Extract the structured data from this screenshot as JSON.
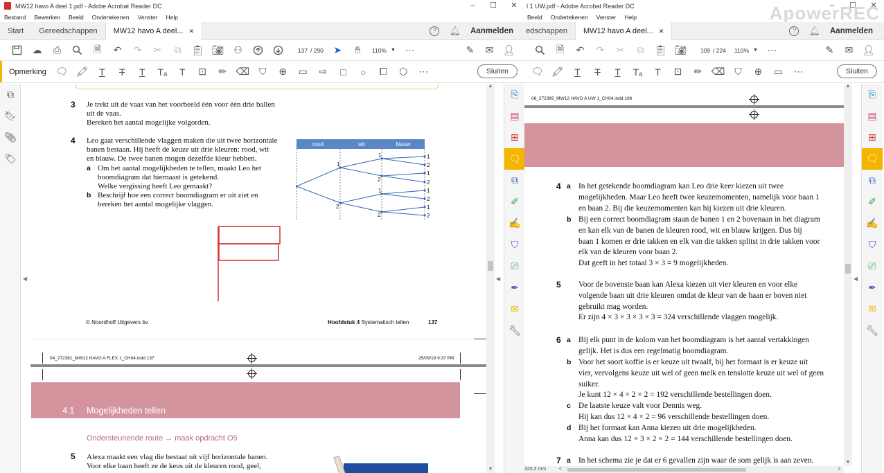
{
  "left_window": {
    "title": "MW12 havo A deel 1.pdf - Adobe Acrobat Reader DC",
    "menu": [
      "Bestand",
      "Bewerken",
      "Beeld",
      "Ondertekenen",
      "Venster",
      "Help"
    ],
    "tabs": {
      "start": "Start",
      "tools": "Gereedschappen",
      "doc": "MW12 havo A deel..."
    },
    "signin": "Aanmelden",
    "page_current": "137",
    "page_total": "/ 290",
    "zoom": "110%",
    "comment_label": "Opmerking",
    "close_label": "Sluiten"
  },
  "right_window": {
    "title": "l 1 UW.pdf - Adobe Acrobat Reader DC",
    "menu": [
      "Beeld",
      "Ondertekenen",
      "Venster",
      "Help"
    ],
    "tabs": {
      "tools": "edschappen",
      "doc": "MW12 havo A deel..."
    },
    "signin": "Aanmelden",
    "page_current": "109",
    "page_total": "/ 224",
    "zoom": "110%",
    "close_label": "Sluiten",
    "watermark": "ApowerREC",
    "status_size": "320,3 mm"
  },
  "left_doc": {
    "q3": {
      "num": "3",
      "lines": [
        "Je trekt uit de vaas van het voorbeeld één voor één drie ballen",
        "uit de vaas.",
        "Bereken het aantal mogelijke volgorden."
      ]
    },
    "q4": {
      "num": "4",
      "intro": [
        "Leo gaat verschillende vlaggen maken die uit twee horizontale",
        "banen bestaan. Hij heeft de keuze uit drie kleuren: rood, wit",
        "en blauw. De twee banen mogen dezelfde kleur hebben."
      ],
      "a_label": "a",
      "a_lines": [
        "Om het aantal mogelijkheden te tellen, maakt Leo het",
        "boomdiagram dat hiernaast is getekend.",
        "Welke vergissing heeft Leo gemaakt?"
      ],
      "b_label": "b",
      "b_lines": [
        "Beschrijf hoe een correct boomdiagram er uit ziet en",
        "bereken het aantal mogelijke vlaggen."
      ]
    },
    "tree": {
      "headers": [
        "rood",
        "wit",
        "blauw"
      ],
      "level1": [
        "1",
        "2"
      ],
      "level2": [
        "1",
        "2",
        "1",
        "2"
      ],
      "leaves": [
        "1",
        "2",
        "1",
        "2",
        "1",
        "2",
        "1",
        "2"
      ]
    },
    "footer": {
      "copyright": "© Noordhoff Uitgevers bv",
      "chapter_bold": "Hoofdstuk 4",
      "chapter_rest": " Systematisch tellen",
      "page": "137"
    },
    "slug": {
      "file": "04_272381_MW12 HAVO A FLEX 1_CH04.indd   137",
      "date": "25/09/19   9:37 PM"
    },
    "section": {
      "num": "4.1",
      "title": "Mogelijkheden tellen"
    },
    "route": "Ondersteunende route → maak opdracht O5",
    "q5": {
      "num": "5",
      "lines": [
        "Alexa maakt een vlag die bestaat uit vijf horizontale banen.",
        "Voor elke baan heeft ze de keus uit de kleuren rood, geel,"
      ]
    }
  },
  "right_doc": {
    "slug": "06_272389_MW12 HAVO A UW 1_CH04.indd   108",
    "answers": [
      {
        "num": "4",
        "label": "a",
        "lines": [
          "In het getekende boomdiagram kan Leo drie keer kiezen uit twee",
          "mogelijkheden. Maar Leo heeft twee keuzemomenten, namelijk voor baan 1",
          "en baan 2. Bij die keuzemomenten kan hij kiezen uit drie kleuren."
        ]
      },
      {
        "num": "",
        "label": "b",
        "lines": [
          "Bij een correct boomdiagram staan de banen 1 en 2 bovenaan in het diagram",
          "en kan elk van de banen de kleuren rood, wit en blauw krijgen. Dus bij",
          "baan 1 komen er drie takken en elk van die takken splitst in drie takken voor",
          "elk van de kleuren voor baan 2.",
          "Dat geeft in het totaal 3 × 3 = 9 mogelijkheden."
        ]
      },
      {
        "num": "5",
        "label": "",
        "lines": [
          "Voor de bovenste baan kan Alexa kiezen uit vier kleuren en voor elke",
          "volgende baan uit drie kleuren omdat de kleur van de baan er boven niet",
          "gebruikt mag worden.",
          "Er zijn 4 × 3 × 3 × 3 × 3 = 324 verschillende vlaggen mogelijk."
        ]
      },
      {
        "num": "6",
        "label": "a",
        "lines": [
          "Bij elk punt in de kolom van het boomdiagram is het aantal vertakkingen",
          "gelijk. Het is dus een regelmatig boomdiagram."
        ]
      },
      {
        "num": "",
        "label": "b",
        "lines": [
          "Voor het soort koffie is er keuze uit twaalf, bij het formaat is er keuze uit",
          "vier, vervolgens keuze uit wel of geen melk en tenslotte keuze uit wel of geen",
          "suiker.",
          "Je kunt 12 × 4 × 2 × 2 = 192 verschillende bestellingen doen."
        ]
      },
      {
        "num": "",
        "label": "c",
        "lines": [
          "De laatste keuze valt voor Dennis weg.",
          "Hij kan dus 12 × 4 × 2 = 96 verschillende bestellingen doen."
        ]
      },
      {
        "num": "",
        "label": "d",
        "lines": [
          "Bij het formaat kan Anna kiezen uit drie mogelijkheden.",
          "Anna kan dus 12 × 3 × 2 × 2 = 144 verschillende bestellingen doen."
        ]
      },
      {
        "num": "7",
        "label": "a",
        "lines": [
          "In het schema zie je dat er 6 gevallen zijn waar de som gelijk is aan zeven."
        ]
      }
    ]
  }
}
